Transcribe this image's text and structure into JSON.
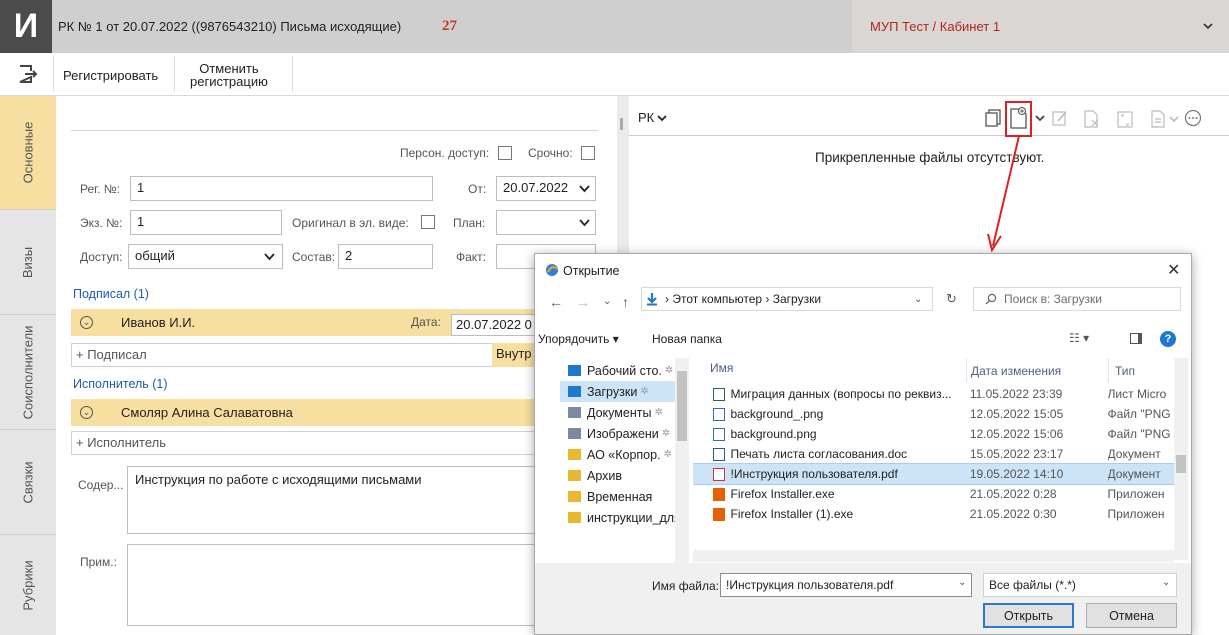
{
  "app": {
    "logo": "И",
    "title": "РК № 1 от 20.07.2022 ((9876543210) Письма исходящие)",
    "count": "27",
    "org": "МУП Тест / Кабинет 1"
  },
  "toolbar": {
    "register": "Регистрировать",
    "cancel_line1": "Отменить",
    "cancel_line2": "регистрацию"
  },
  "side_tabs": [
    "Основные",
    "Визы",
    "Соисполнители",
    "Связки",
    "Рубрики"
  ],
  "form": {
    "person_access": "Персон. доступ:",
    "urgent": "Срочно:",
    "reg_no_label": "Рег. №:",
    "reg_no": "1",
    "from_label": "От:",
    "from_date": "20.07.2022",
    "copy_label": "Экз. №:",
    "copy_no": "1",
    "original_label": "Оригинал в эл. виде:",
    "plan_label": "План:",
    "access_label": "Доступ:",
    "access_value": "общий",
    "composition_label": "Состав:",
    "composition_value": "2",
    "fact_label": "Факт:",
    "signed_header": "Подписал (1)",
    "signer_name": "Иванов И.И.",
    "date_label": "Дата:",
    "sign_date": "20.07.2022 0",
    "add_signer": "+ Подписал",
    "internal": "Внутр",
    "executor_header": "Исполнитель (1)",
    "executor_name": "Смоляр Алина Салаватовна",
    "add_executor": "+ Исполнитель",
    "content_label": "Содер...",
    "content_value": "Инструкция по работе с исходящими письмами",
    "note_label": "Прим.:"
  },
  "rk_panel": {
    "dropdown": "РК",
    "no_files": "Прикрепленные файлы отсутствуют."
  },
  "dialog": {
    "title": "Открытие",
    "path_pc": "Этот компьютер",
    "path_folder": "Загрузки",
    "search_placeholder": "Поиск в: Загрузки",
    "organize": "Упорядочить ▾",
    "new_folder": "Новая папка",
    "nav_items": [
      {
        "label": "Рабочий сто.",
        "color": "#1e78d0"
      },
      {
        "label": "Загрузки",
        "color": "#1e78d0"
      },
      {
        "label": "Документы",
        "color": "#7a8aa0"
      },
      {
        "label": "Изображени",
        "color": "#7a8aa0"
      },
      {
        "label": "АО «Корпор.",
        "color": "#e8b830"
      },
      {
        "label": "Архив",
        "color": "#e8b830"
      },
      {
        "label": "Временная",
        "color": "#e8b830"
      },
      {
        "label": "инструкции_для",
        "color": "#e8b830"
      }
    ],
    "col_name": "Имя",
    "col_date": "Дата изменения",
    "col_type": "Тип",
    "files": [
      {
        "name": "Миграция данных (вопросы по реквиз...",
        "date": "11.05.2022 23:39",
        "type": "Лист Micro",
        "icon": "xlsx-icon",
        "color": "#1e7145"
      },
      {
        "name": "background_.png",
        "date": "12.05.2022 15:05",
        "type": "Файл \"PNG",
        "icon": "png-icon",
        "color": "#2f6db5"
      },
      {
        "name": "background.png",
        "date": "12.05.2022 15:06",
        "type": "Файл \"PNG",
        "icon": "png-icon",
        "color": "#2f6db5"
      },
      {
        "name": "Печать листа согласования.doc",
        "date": "15.05.2022 23:17",
        "type": "Документ",
        "icon": "doc-icon",
        "color": "#2b579a"
      },
      {
        "name": "!Инструкция пользователя.pdf",
        "date": "19.05.2022 14:10",
        "type": "Документ",
        "icon": "pdf-icon",
        "color": "#d9302b"
      },
      {
        "name": "Firefox Installer.exe",
        "date": "21.05.2022 0:28",
        "type": "Приложен",
        "icon": "firefox-icon",
        "color": "#e66000"
      },
      {
        "name": "Firefox Installer (1).exe",
        "date": "21.05.2022 0:30",
        "type": "Приложен",
        "icon": "firefox-icon",
        "color": "#e66000"
      }
    ],
    "filename_label": "Имя файла:",
    "filename_value": "!Инструкция пользователя.pdf",
    "filter": "Все файлы (*.*)",
    "open": "Открыть",
    "cancel": "Отмена"
  }
}
